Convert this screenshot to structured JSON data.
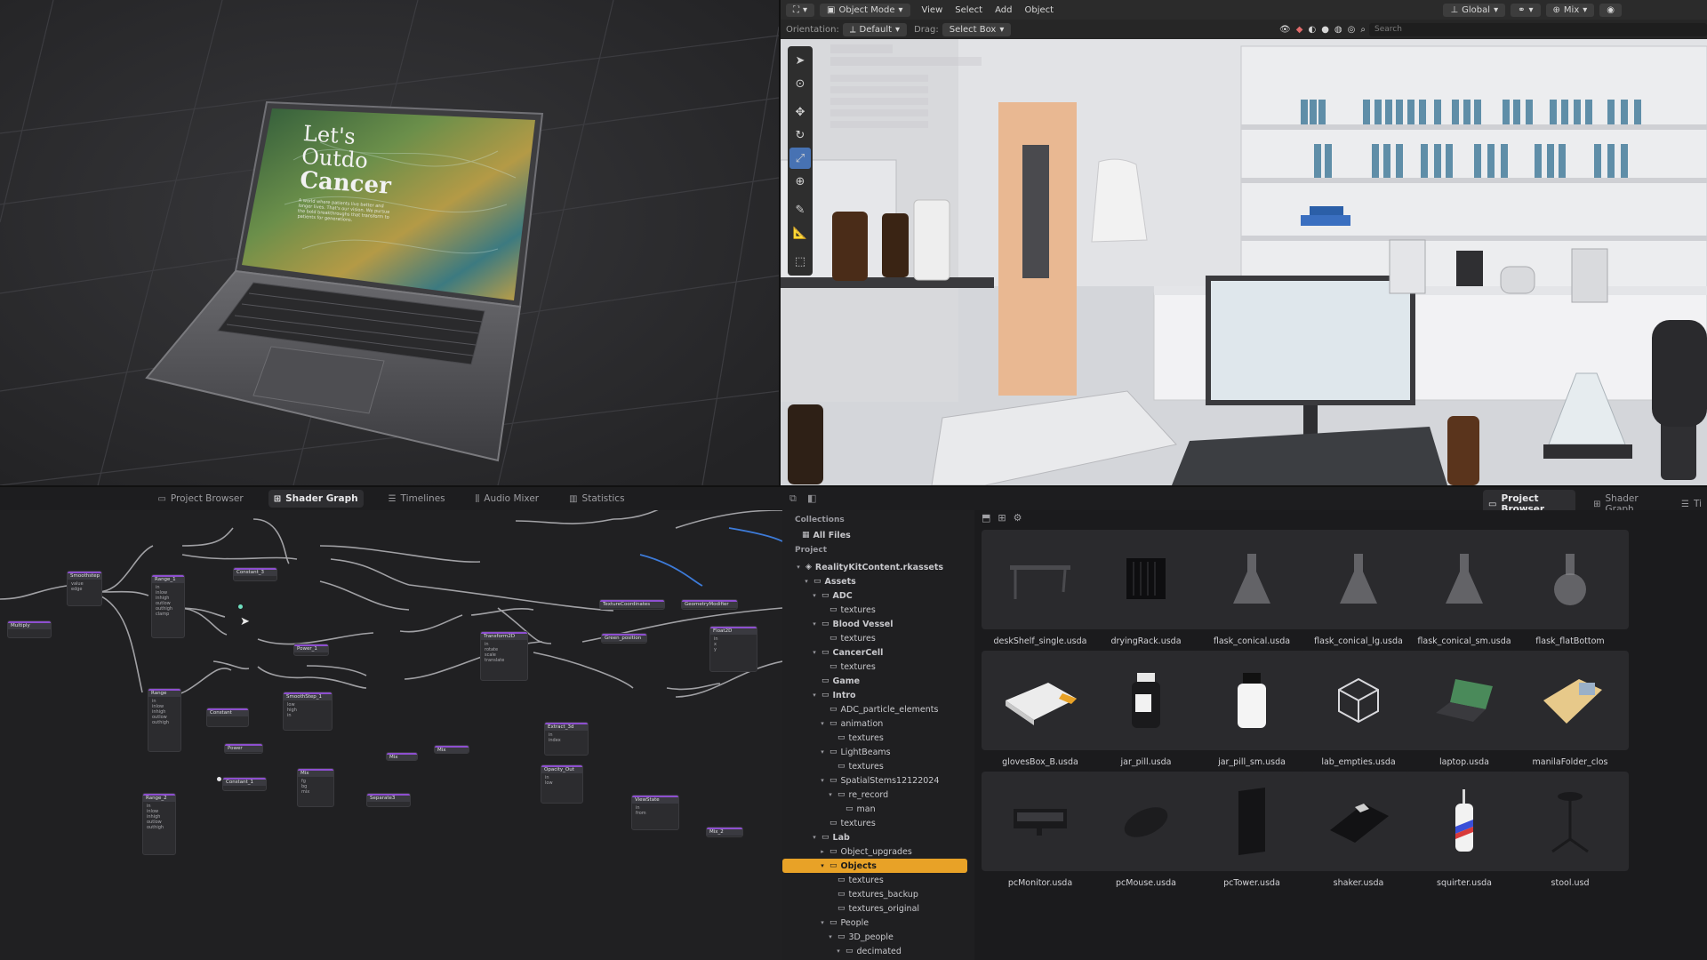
{
  "left_viewport": {
    "laptop_screen": {
      "headline_lines": [
        "Let's",
        "Outdo",
        "Cancer"
      ],
      "body_text": "A world where patients live better and longer lives. That's our vision. We pursue the bold breakthroughs that transform to patients for generations."
    }
  },
  "blender": {
    "header1": {
      "mode": "Object Mode",
      "menus": [
        "View",
        "Select",
        "Add",
        "Object"
      ],
      "transform": "Global",
      "pivot": "Mix"
    },
    "header2": {
      "orientation_label": "Orientation:",
      "orientation_value": "Default",
      "drag_label": "Drag:",
      "drag_value": "Select Box",
      "search_placeholder": "Search"
    },
    "tools": [
      "select-tool",
      "cursor-tool",
      "move-tool",
      "rotate-tool",
      "scale-tool",
      "transform-tool",
      "annotate-tool",
      "measure-tool",
      "add-cube-tool"
    ],
    "active_tool_index": 4
  },
  "shader_graph": {
    "tabs": [
      {
        "label": "Project Browser",
        "icon": "folder-icon"
      },
      {
        "label": "Shader Graph",
        "icon": "graph-icon"
      },
      {
        "label": "Timelines",
        "icon": "timeline-icon"
      },
      {
        "label": "Audio Mixer",
        "icon": "audio-icon"
      },
      {
        "label": "Statistics",
        "icon": "stats-icon"
      }
    ],
    "active_tab": "Shader Graph"
  },
  "project_browser": {
    "header_tabs": [
      {
        "label": "Project Browser",
        "icon": "folder-icon"
      },
      {
        "label": "Shader Graph",
        "icon": "graph-icon"
      },
      {
        "label": "Ti",
        "icon": "timeline-icon"
      }
    ],
    "collections_label": "Collections",
    "all_files": "All Files",
    "project_label": "Project",
    "tree": [
      {
        "label": "RealityKitContent.rkassets",
        "depth": 0,
        "expanded": true
      },
      {
        "label": "Assets",
        "depth": 1,
        "expanded": true
      },
      {
        "label": "ADC",
        "depth": 2,
        "expanded": true
      },
      {
        "label": "textures",
        "depth": 3
      },
      {
        "label": "Blood Vessel",
        "depth": 2,
        "expanded": true
      },
      {
        "label": "textures",
        "depth": 3
      },
      {
        "label": "CancerCell",
        "depth": 2,
        "expanded": true
      },
      {
        "label": "textures",
        "depth": 3
      },
      {
        "label": "Game",
        "depth": 2
      },
      {
        "label": "Intro",
        "depth": 2,
        "expanded": true
      },
      {
        "label": "ADC_particle_elements",
        "depth": 3
      },
      {
        "label": "animation",
        "depth": 3,
        "expanded": true
      },
      {
        "label": "textures",
        "depth": 4
      },
      {
        "label": "LightBeams",
        "depth": 3,
        "expanded": true
      },
      {
        "label": "textures",
        "depth": 4
      },
      {
        "label": "SpatialStems12122024",
        "depth": 3,
        "expanded": true
      },
      {
        "label": "re_record",
        "depth": 4,
        "expanded": true
      },
      {
        "label": "man",
        "depth": 5
      },
      {
        "label": "textures",
        "depth": 3
      },
      {
        "label": "Lab",
        "depth": 2,
        "expanded": true
      },
      {
        "label": "Object_upgrades",
        "depth": 3,
        "collapsed": true
      },
      {
        "label": "Objects",
        "depth": 3,
        "expanded": true,
        "selected": true
      },
      {
        "label": "textures",
        "depth": 4
      },
      {
        "label": "textures_backup",
        "depth": 4
      },
      {
        "label": "textures_original",
        "depth": 4
      },
      {
        "label": "People",
        "depth": 3,
        "expanded": true
      },
      {
        "label": "3D_people",
        "depth": 4,
        "expanded": true
      },
      {
        "label": "decimated",
        "depth": 5,
        "expanded": true
      }
    ],
    "assets": [
      {
        "name": "deskShelf_single.usda",
        "icon": "shelf-thumb"
      },
      {
        "name": "dryingRack.usda",
        "icon": "rack-thumb"
      },
      {
        "name": "flask_conical.usda",
        "icon": "flask-thumb"
      },
      {
        "name": "flask_conical_lg.usda",
        "icon": "flask-thumb"
      },
      {
        "name": "flask_conical_sm.usda",
        "icon": "flask-thumb"
      },
      {
        "name": "flask_flatBottom",
        "icon": "flask-round-thumb"
      },
      {
        "name": "glovesBox_B.usda",
        "icon": "box-thumb"
      },
      {
        "name": "jar_pill.usda",
        "icon": "jar-dark-thumb"
      },
      {
        "name": "jar_pill_sm.usda",
        "icon": "jar-white-thumb"
      },
      {
        "name": "lab_empties.usda",
        "icon": "cube-wire-thumb"
      },
      {
        "name": "laptop.usda",
        "icon": "laptop-thumb"
      },
      {
        "name": "manilaFolder_clos",
        "icon": "folder-thumb"
      },
      {
        "name": "pcMonitor.usda",
        "icon": "monitor-thumb"
      },
      {
        "name": "pcMouse.usda",
        "icon": "mouse-thumb"
      },
      {
        "name": "pcTower.usda",
        "icon": "tower-thumb"
      },
      {
        "name": "shaker.usda",
        "icon": "shaker-thumb"
      },
      {
        "name": "squirter.usda",
        "icon": "squirter-thumb"
      },
      {
        "name": "stool.usd",
        "icon": "stool-thumb"
      }
    ]
  },
  "colors": {
    "selection": "#e8a227",
    "active_tool": "#4772b3",
    "node_accent": "#8e4fd0",
    "wire": "#b8b8bc",
    "wire_blue": "#3d7bd9"
  }
}
